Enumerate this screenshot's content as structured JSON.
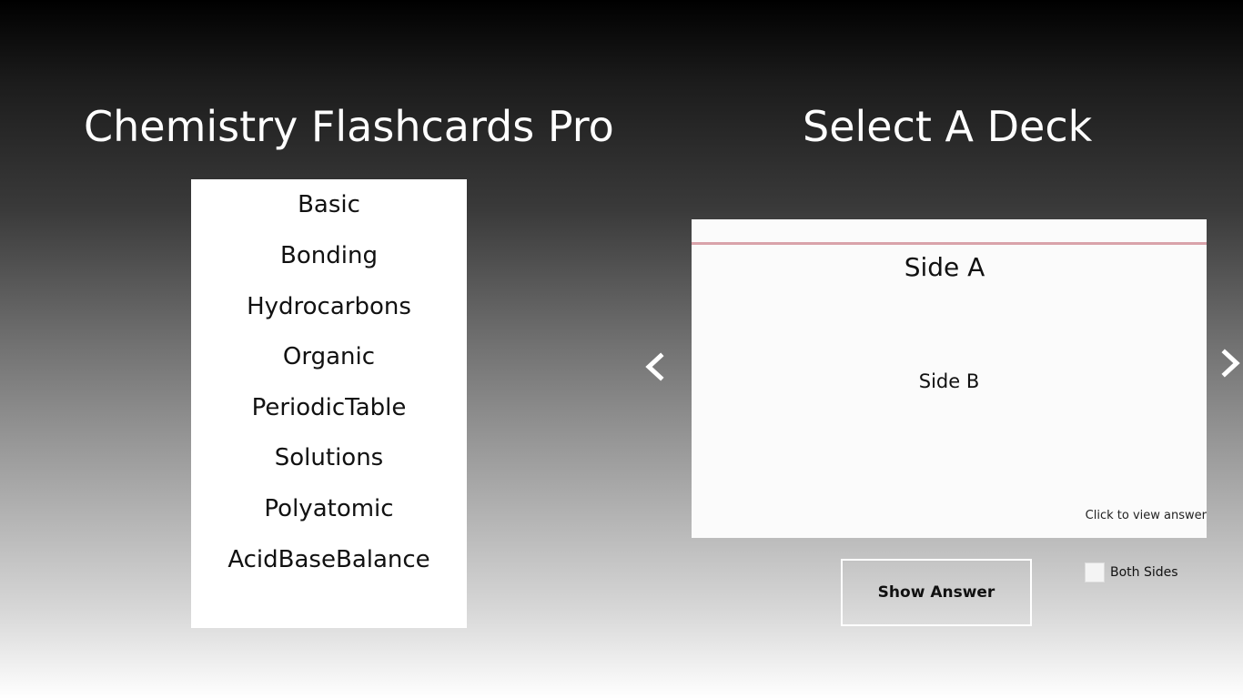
{
  "header": {
    "app_title": "Chemistry Flashcards Pro",
    "deck_title": "Select A Deck"
  },
  "decks": [
    {
      "label": "Basic"
    },
    {
      "label": "Bonding"
    },
    {
      "label": "Hydrocarbons"
    },
    {
      "label": "Organic"
    },
    {
      "label": "PeriodicTable"
    },
    {
      "label": "Solutions"
    },
    {
      "label": "Polyatomic"
    },
    {
      "label": "AcidBaseBalance"
    }
  ],
  "card": {
    "side_a": "Side A",
    "side_b": "Side B",
    "hint": "Click to view answer"
  },
  "controls": {
    "show_answer_label": "Show Answer",
    "both_sides_label": "Both Sides",
    "both_sides_checked": false,
    "prev_icon": "chevron-left-icon",
    "next_icon": "chevron-right-icon"
  },
  "colors": {
    "card_margin_line": "#d9a3aa",
    "card_rule_line": "#a9d3d6"
  }
}
